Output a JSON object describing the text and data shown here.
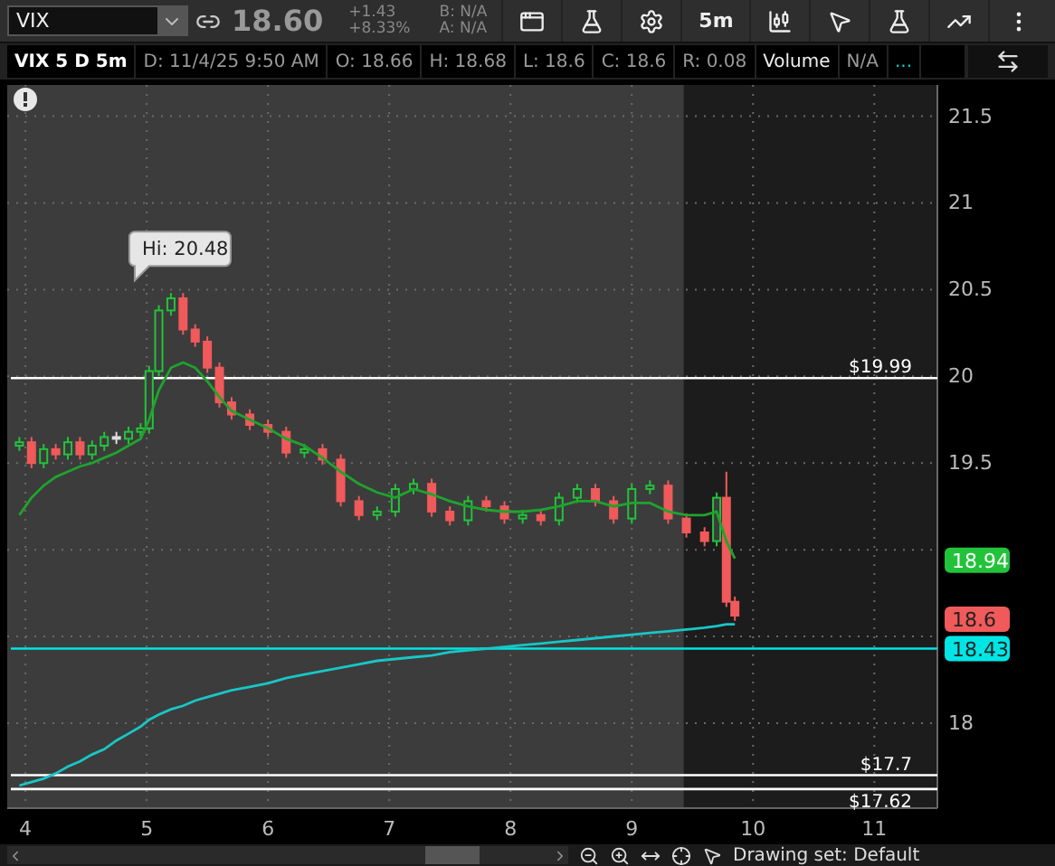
{
  "toolbar": {
    "symbol": "VIX",
    "last": "18.60",
    "change": "+1.43",
    "change_pct": "+8.33%",
    "bid": "B: N/A",
    "ask": "A: N/A",
    "interval": "5m"
  },
  "info_bar": {
    "title": "VIX 5 D 5m",
    "cells": [
      {
        "text": "D: 11/4/25 9:50 AM",
        "kind": "muted"
      },
      {
        "text": "O: 18.66",
        "kind": "muted"
      },
      {
        "text": "H: 18.68",
        "kind": "muted"
      },
      {
        "text": "L: 18.6",
        "kind": "muted"
      },
      {
        "text": "C: 18.6",
        "kind": "muted"
      },
      {
        "text": "R: 0.08",
        "kind": "muted"
      },
      {
        "text": "Volume",
        "kind": "bright"
      },
      {
        "text": "N/A",
        "kind": "muted"
      },
      {
        "text": "...",
        "kind": "accent"
      }
    ]
  },
  "chart": {
    "chart_data": {
      "type": "candlestick",
      "grid": true,
      "xlim": [
        3.85,
        11.52
      ],
      "ylim": [
        17.51,
        21.68
      ],
      "xticks": [
        4,
        5,
        6,
        7,
        8,
        9,
        10,
        11
      ],
      "yticks": [
        18,
        19.5,
        20,
        20.5,
        21,
        21.5
      ],
      "x": [
        3.95,
        4.05,
        4.15,
        4.25,
        4.35,
        4.45,
        4.55,
        4.65,
        4.75,
        4.85,
        4.95,
        5.02,
        5.1,
        5.2,
        5.3,
        5.4,
        5.5,
        5.6,
        5.7,
        5.85,
        6.0,
        6.15,
        6.3,
        6.45,
        6.6,
        6.75,
        6.9,
        7.05,
        7.2,
        7.35,
        7.5,
        7.65,
        7.8,
        7.95,
        8.1,
        8.25,
        8.4,
        8.55,
        8.7,
        8.85,
        9.0,
        9.15,
        9.3,
        9.45,
        9.6,
        9.7,
        9.78,
        9.85
      ],
      "ohlc": [
        [
          19.6,
          19.65,
          19.57,
          19.62
        ],
        [
          19.62,
          19.65,
          19.47,
          19.5
        ],
        [
          19.5,
          19.61,
          19.47,
          19.58
        ],
        [
          19.58,
          19.61,
          19.52,
          19.55
        ],
        [
          19.55,
          19.65,
          19.52,
          19.62
        ],
        [
          19.62,
          19.65,
          19.52,
          19.55
        ],
        [
          19.55,
          19.63,
          19.52,
          19.6
        ],
        [
          19.6,
          19.68,
          19.57,
          19.65
        ],
        [
          19.65,
          19.68,
          19.61,
          19.64
        ],
        [
          19.64,
          19.71,
          19.61,
          19.68
        ],
        [
          19.68,
          19.73,
          19.65,
          19.7
        ],
        [
          19.7,
          20.06,
          19.67,
          20.03
        ],
        [
          20.03,
          20.41,
          20.0,
          20.38
        ],
        [
          20.38,
          20.48,
          20.35,
          20.45
        ],
        [
          20.45,
          20.48,
          20.24,
          20.27
        ],
        [
          20.27,
          20.3,
          20.17,
          20.2
        ],
        [
          20.2,
          20.23,
          20.02,
          20.05
        ],
        [
          20.05,
          20.08,
          19.82,
          19.85
        ],
        [
          19.85,
          19.88,
          19.75,
          19.78
        ],
        [
          19.78,
          19.81,
          19.69,
          19.72
        ],
        [
          19.72,
          19.75,
          19.65,
          19.68
        ],
        [
          19.68,
          19.71,
          19.53,
          19.56
        ],
        [
          19.56,
          19.61,
          19.53,
          19.58
        ],
        [
          19.58,
          19.61,
          19.49,
          19.52
        ],
        [
          19.52,
          19.55,
          19.25,
          19.28
        ],
        [
          19.28,
          19.31,
          19.17,
          19.2
        ],
        [
          19.2,
          19.25,
          19.17,
          19.22
        ],
        [
          19.22,
          19.38,
          19.19,
          19.35
        ],
        [
          19.35,
          19.41,
          19.32,
          19.38
        ],
        [
          19.38,
          19.41,
          19.19,
          19.22
        ],
        [
          19.22,
          19.25,
          19.14,
          19.17
        ],
        [
          19.17,
          19.31,
          19.14,
          19.28
        ],
        [
          19.28,
          19.31,
          19.22,
          19.25
        ],
        [
          19.25,
          19.28,
          19.15,
          19.18
        ],
        [
          19.18,
          19.23,
          19.15,
          19.2
        ],
        [
          19.2,
          19.23,
          19.14,
          19.17
        ],
        [
          19.17,
          19.33,
          19.14,
          19.3
        ],
        [
          19.3,
          19.38,
          19.27,
          19.35
        ],
        [
          19.35,
          19.38,
          19.25,
          19.28
        ],
        [
          19.28,
          19.31,
          19.15,
          19.18
        ],
        [
          19.18,
          19.38,
          19.15,
          19.35
        ],
        [
          19.35,
          19.4,
          19.32,
          19.37
        ],
        [
          19.37,
          19.4,
          19.15,
          19.18
        ],
        [
          19.18,
          19.21,
          19.07,
          19.1
        ],
        [
          19.1,
          19.13,
          19.02,
          19.05
        ],
        [
          19.05,
          19.33,
          19.02,
          19.3
        ],
        [
          19.3,
          19.45,
          18.67,
          18.7
        ],
        [
          18.7,
          18.73,
          18.59,
          18.62
        ]
      ],
      "series": [
        {
          "type": "line",
          "color": "#1fa32e",
          "values": [
            19.2,
            19.3,
            19.37,
            19.42,
            19.45,
            19.48,
            19.5,
            19.53,
            19.56,
            19.6,
            19.64,
            19.75,
            19.92,
            20.05,
            20.08,
            20.05,
            19.97,
            19.88,
            19.8,
            19.75,
            19.7,
            19.64,
            19.6,
            19.53,
            19.45,
            19.38,
            19.33,
            19.3,
            19.35,
            19.32,
            19.28,
            19.25,
            19.23,
            19.22,
            19.22,
            19.23,
            19.25,
            19.28,
            19.28,
            19.25,
            19.27,
            19.27,
            19.22,
            19.2,
            19.2,
            19.22,
            19.05,
            18.95
          ]
        },
        {
          "type": "line",
          "color": "#19c6c6",
          "values": [
            17.64,
            17.66,
            17.68,
            17.71,
            17.75,
            17.78,
            17.82,
            17.85,
            17.9,
            17.94,
            17.98,
            18.02,
            18.05,
            18.08,
            18.1,
            18.13,
            18.15,
            18.17,
            18.19,
            18.21,
            18.23,
            18.26,
            18.28,
            18.3,
            18.32,
            18.34,
            18.36,
            18.37,
            18.38,
            18.39,
            18.41,
            18.42,
            18.43,
            18.44,
            18.45,
            18.46,
            18.47,
            18.48,
            18.49,
            18.5,
            18.51,
            18.52,
            18.53,
            18.54,
            18.55,
            18.56,
            18.57,
            18.57
          ]
        }
      ],
      "ref_lines": [
        {
          "axis": "y",
          "value": 19.99,
          "label": "$19.99",
          "color": "#ffffff"
        },
        {
          "axis": "y",
          "value": 18.43,
          "color": "#00e5e5"
        },
        {
          "axis": "y",
          "value": 17.7,
          "label": "$17.7",
          "color": "#ffffff"
        },
        {
          "axis": "y",
          "value": 17.62,
          "label": "$17.62",
          "color": "#ffffff"
        }
      ],
      "bands": [
        {
          "axis": "x",
          "from": 3.85,
          "to": 9.43,
          "color": "#3c3c3c"
        },
        {
          "axis": "x",
          "from": 9.43,
          "to": 11.52,
          "color": "#1c1c1c"
        }
      ],
      "annotations": [
        {
          "text": "Hi: 20.48",
          "x": 5.2,
          "y": 20.48
        }
      ]
    },
    "price_tags": [
      {
        "label": "18.94",
        "color": "#22c33a"
      },
      {
        "label": "18.6",
        "color": "#f05a5a"
      },
      {
        "label": "18.43",
        "color": "#00e5e5"
      }
    ]
  },
  "status_bar": {
    "drawing_set": "Drawing set: Default"
  }
}
